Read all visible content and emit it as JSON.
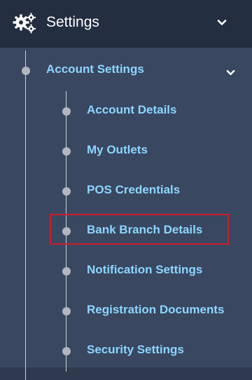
{
  "header": {
    "icon": "gears-icon",
    "title": "Settings",
    "chevron": "chevron-down-icon"
  },
  "section": {
    "title": "Account Settings",
    "chevron": "chevron-down-icon"
  },
  "sub_items": [
    {
      "label": "Account Details"
    },
    {
      "label": "My Outlets"
    },
    {
      "label": "POS Credentials"
    },
    {
      "label": "Bank Branch Details",
      "highlighted": true
    },
    {
      "label": "Notification Settings"
    },
    {
      "label": "Registration Documents"
    },
    {
      "label": "Security Settings"
    }
  ],
  "colors": {
    "header_bg": "#232e41",
    "panel_bg": "#3a4761",
    "link_text": "#8cd6ff",
    "highlight_border": "#cc1f2b",
    "dot": "#b3b6bd"
  }
}
